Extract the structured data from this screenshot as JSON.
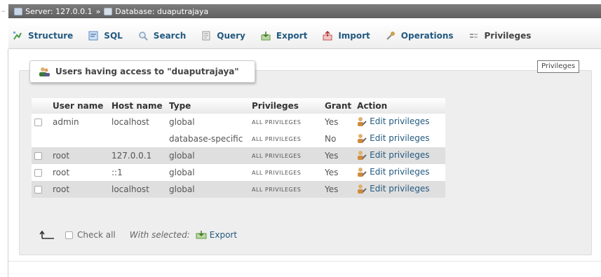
{
  "breadcrumb": {
    "server": "Server: 127.0.0.1",
    "separator": "»",
    "database": "Database: duaputrajaya"
  },
  "tabs": [
    {
      "label": "Structure",
      "icon": "structure-icon"
    },
    {
      "label": "SQL",
      "icon": "sql-icon"
    },
    {
      "label": "Search",
      "icon": "search-icon"
    },
    {
      "label": "Query",
      "icon": "query-icon"
    },
    {
      "label": "Export",
      "icon": "export-icon"
    },
    {
      "label": "Import",
      "icon": "import-icon"
    },
    {
      "label": "Operations",
      "icon": "wrench-icon"
    },
    {
      "label": "Privileges",
      "icon": "privileges-icon"
    }
  ],
  "panel": {
    "legend": "Users having access to \"duaputrajaya\"",
    "tooltip": "Privileges"
  },
  "table": {
    "headers": [
      "User name",
      "Host name",
      "Type",
      "Privileges",
      "Grant",
      "Action"
    ],
    "rows": [
      {
        "user": "admin",
        "host": "localhost",
        "type": "global",
        "privileges": "ALL PRIVILEGES",
        "grant": "Yes",
        "action": "Edit privileges"
      },
      {
        "user": "",
        "host": "",
        "type": "database-specific",
        "privileges": "ALL PRIVILEGES",
        "grant": "No",
        "action": "Edit privileges"
      },
      {
        "user": "root",
        "host": "127.0.0.1",
        "type": "global",
        "privileges": "ALL PRIVILEGES",
        "grant": "Yes",
        "action": "Edit privileges"
      },
      {
        "user": "root",
        "host": "::1",
        "type": "global",
        "privileges": "ALL PRIVILEGES",
        "grant": "Yes",
        "action": "Edit privileges"
      },
      {
        "user": "root",
        "host": "localhost",
        "type": "global",
        "privileges": "ALL PRIVILEGES",
        "grant": "Yes",
        "action": "Edit privileges"
      }
    ]
  },
  "footer": {
    "check_all": "Check all",
    "with_selected": "With selected:",
    "export": "Export"
  },
  "colors": {
    "link": "#235a81",
    "breadcrumb_bg": "#6e6e6e",
    "panel_bg": "#eeeeee",
    "row_even": "#dfdfdf"
  }
}
